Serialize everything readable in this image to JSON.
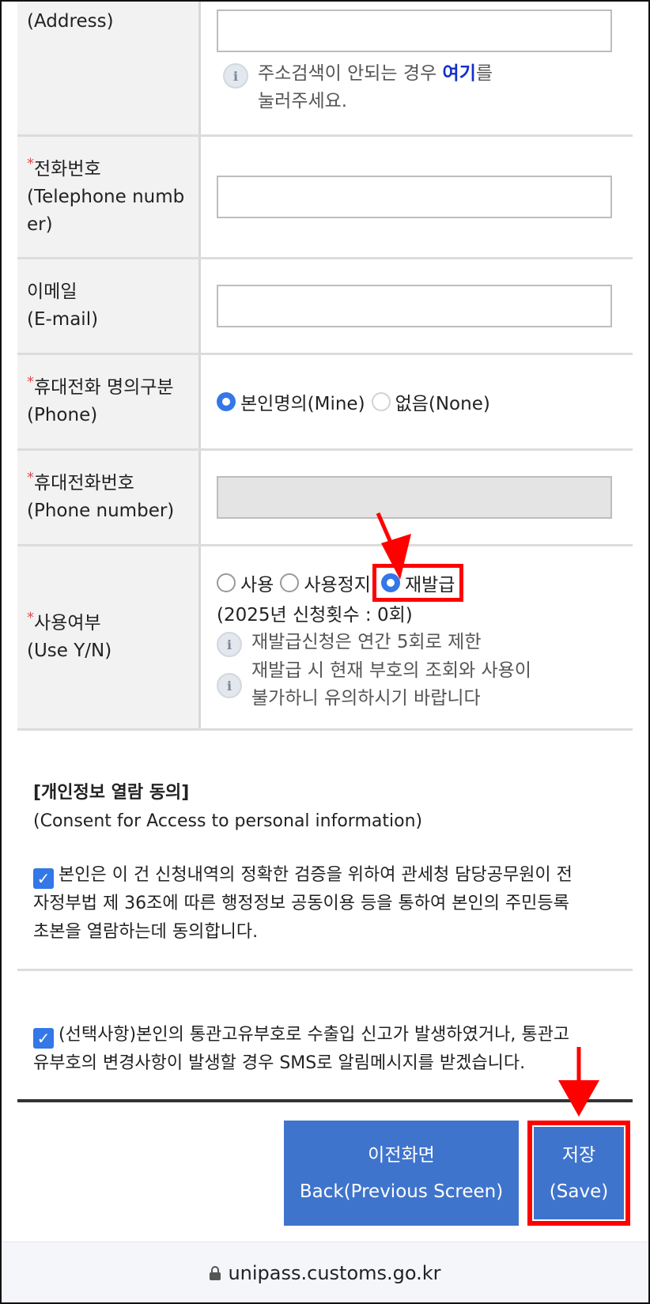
{
  "form": {
    "address": {
      "label": "(Address)",
      "info_prefix": "주소검색이 안되는 경우 ",
      "info_link": "여기",
      "info_suffix": "를",
      "info_line2": "눌러주세요."
    },
    "telephone": {
      "label_ko": "전화번호",
      "label_en_1": "(Telephone numb",
      "label_en_2": "er)"
    },
    "email": {
      "label_ko": "이메일",
      "label_en": "(E-mail)"
    },
    "phone_owner": {
      "label_ko": "휴대전화 명의구분",
      "label_en": "(Phone)",
      "option_mine": "본인명의(Mine)",
      "option_none": "없음(None)"
    },
    "phone_number": {
      "label_ko": "휴대전화번호",
      "label_en": "(Phone number)"
    },
    "use_yn": {
      "label_ko": "사용여부",
      "label_en": "(Use Y/N)",
      "option_use": "사용",
      "option_suspend": "사용정지",
      "option_reissue": "재발급",
      "count_text": "(2025년 신청횟수 : 0회)",
      "info1": "재발급신청은 연간 5회로 제한",
      "info2_line1": "재발급 시 현재 부호의 조회와 사용이",
      "info2_line2": "불가하니 유의하시기 바랍니다"
    },
    "required_mark": "*"
  },
  "consent": {
    "title": "[개인정보 열람 동의]",
    "subtitle": "(Consent for Access to personal information)",
    "check1_line1": "본인은 이 건 신청내역의 정확한 검증을 위하여 관세청 담당공무원이 전",
    "check1_line2": "자정부법 제 36조에 따른 행정정보 공동이용 등을 통하여 본인의 주민등록",
    "check1_line3": "초본을 열람하는데 동의합니다.",
    "check2_line1": "(선택사항)본인의 통관고유부호로 수출입 신고가 발생하였거나, 통관고",
    "check2_line2": "유부호의 변경사항이 발생할 경우 SMS로 알림메시지를 받겠습니다."
  },
  "buttons": {
    "back_ko": "이전화면",
    "back_en": "Back(Previous Screen)",
    "save_ko": "저장",
    "save_en": "(Save)"
  },
  "browser": {
    "url": "unipass.customs.go.kr"
  },
  "colors": {
    "accent": "#3f74cc",
    "highlight": "#ff0000",
    "link": "#1230c8",
    "required": "#e04b4b"
  },
  "icons": {
    "info": "info-icon",
    "lock": "lock-icon",
    "arrow": "red-arrow-icon",
    "check": "checkbox-checked-icon"
  }
}
